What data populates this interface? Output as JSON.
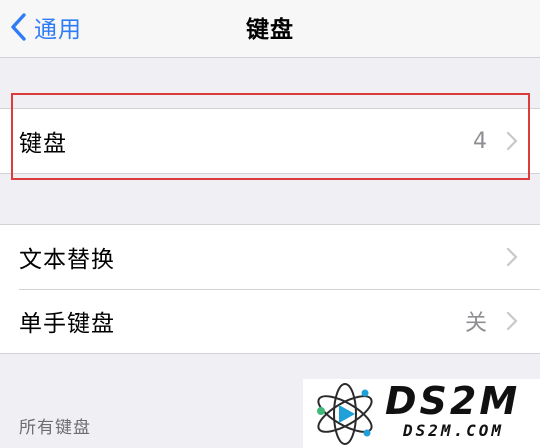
{
  "nav": {
    "back_label": "通用",
    "title": "键盘"
  },
  "keyboards_cell": {
    "label": "键盘",
    "value": "4"
  },
  "settings_group": {
    "items": [
      {
        "label": "文本替换",
        "value": ""
      },
      {
        "label": "单手键盘",
        "value": "关"
      }
    ]
  },
  "section_header": "所有键盘",
  "watermark": {
    "brand": "DS2M",
    "domain": "DS2M.COM"
  },
  "colors": {
    "accent": "#2f7cf6",
    "highlight": "#dc3c3c",
    "background": "#efeff4",
    "secondary_text": "#8e8e93"
  }
}
